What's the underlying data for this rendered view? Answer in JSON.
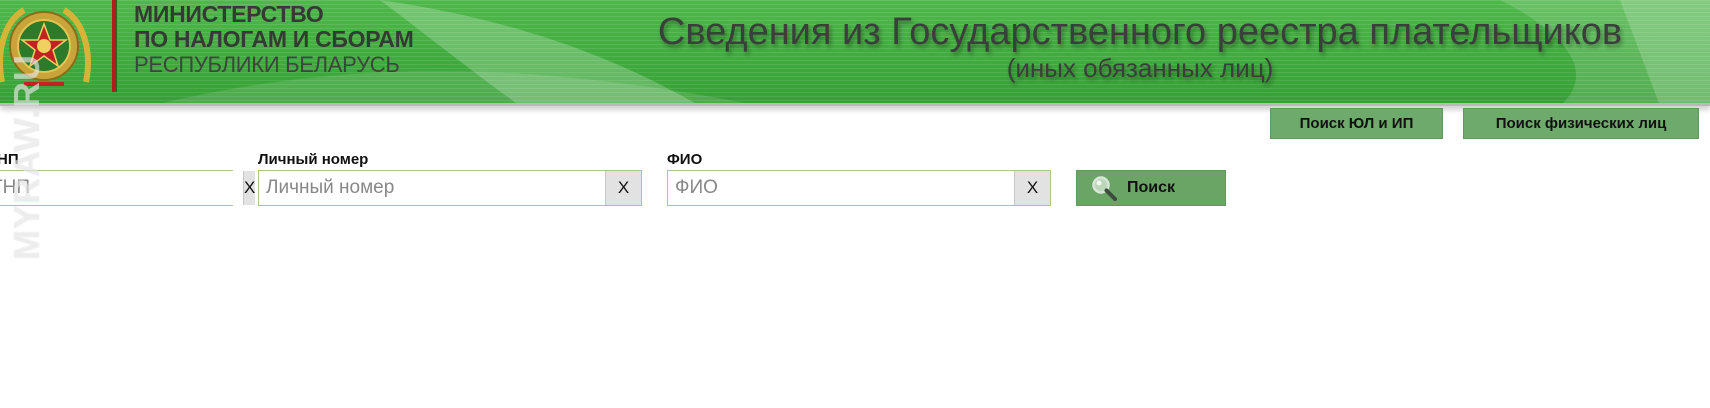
{
  "header": {
    "ministry_line1": "МИНИСТЕРСТВО",
    "ministry_line2": "ПО НАЛОГАМ И СБОРАМ",
    "ministry_line3": "РЕСПУБЛИКИ БЕЛАРУСЬ",
    "title": "Сведения из Государственного реестра плательщиков",
    "subtitle": "(иных обязанных лиц)",
    "emblem_icon": "ministry-emblem-icon",
    "watermark": "MYRAW.RU"
  },
  "nav": {
    "tab_ul_ip": "Поиск ЮЛ и ИП",
    "tab_fiz": "Поиск физических лиц"
  },
  "form": {
    "unp": {
      "label": "НП",
      "placeholder": "ТНП",
      "value": "",
      "clear": "X"
    },
    "lichny": {
      "label": "Личный номер",
      "placeholder": "Личный номер",
      "value": "",
      "clear": "X"
    },
    "fio": {
      "label": "ФИО",
      "placeholder": "ФИО",
      "value": "",
      "clear": "X"
    },
    "search_label": "Поиск",
    "search_icon": "magnifier-icon"
  },
  "colors": {
    "header_green": "#3faa3d",
    "tab_green": "#6faa6d",
    "button_green": "#6aa566",
    "input_border": "#a7c98c"
  }
}
